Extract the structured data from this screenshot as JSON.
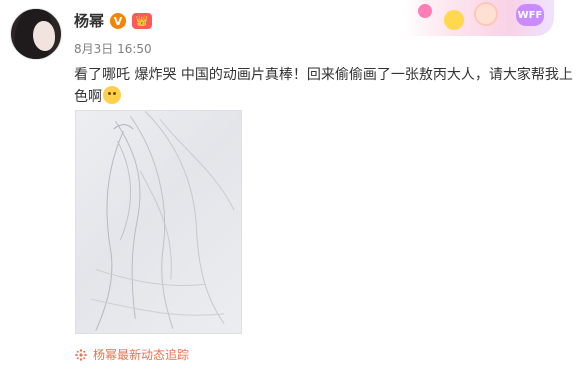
{
  "user": {
    "name": "杨幂",
    "vip_badge": "V",
    "crown_badge": "👑",
    "post_time": "8月3日 16:50"
  },
  "decor": {
    "tag": "WFF"
  },
  "post": {
    "text": "看了哪吒 爆炸哭 中国的动画片真棒！回来偷偷画了一张敖丙大人，请大家帮我上色啊",
    "emoji": "hug-emoji",
    "image_alt": "pencil-sketch"
  },
  "footer": {
    "link_text": "杨幂最新动态追踪",
    "link_color": "#eb7350"
  }
}
